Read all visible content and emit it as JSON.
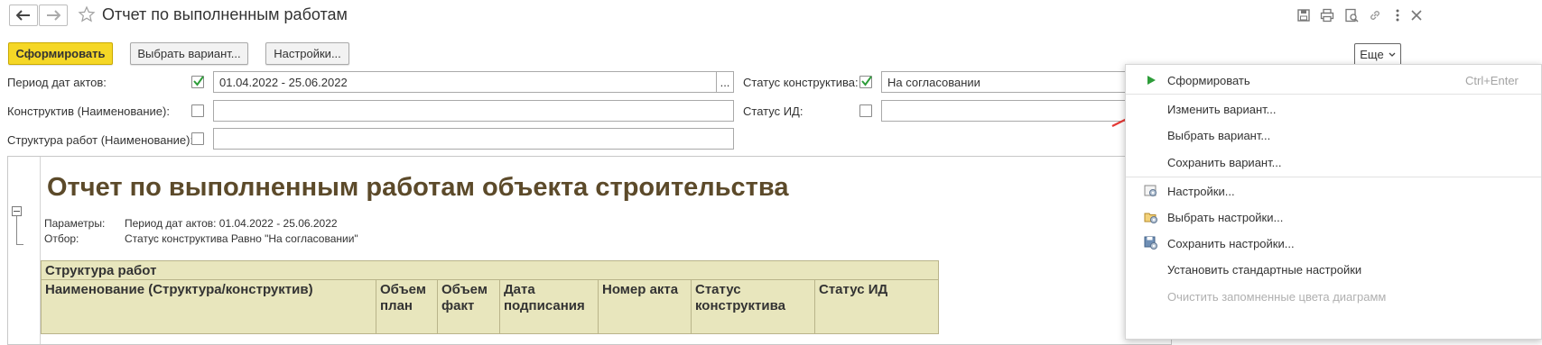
{
  "window": {
    "title": "Отчет по выполненным работам"
  },
  "toolbar": {
    "generate_label": "Сформировать",
    "choose_variant_label": "Выбрать вариант...",
    "settings_label": "Настройки...",
    "more_label": "Еще"
  },
  "filters": {
    "period_label": "Период дат актов:",
    "period_checked": true,
    "period_value": "01.04.2022 - 25.06.2022",
    "period_select_label": "...",
    "construct_label": "Конструктив (Наименование):",
    "construct_checked": false,
    "construct_value": "",
    "structure_label": "Структура работ (Наименование):",
    "structure_checked": false,
    "structure_value": "",
    "construct_status_label": "Статус конструктива:",
    "construct_status_checked": true,
    "construct_status_value": "На согласовании",
    "id_status_label": "Статус ИД:",
    "id_status_checked": false,
    "id_status_value": ""
  },
  "report": {
    "title": "Отчет по выполненным работам объекта строительства",
    "params_label": "Параметры:",
    "params_value": "Период дат актов: 01.04.2022 - 25.06.2022",
    "filter_label": "Отбор:",
    "filter_value": "Статус конструктива Равно \"На согласовании\"",
    "group_header": "Структура работ",
    "columns": [
      "Наименование (Структура/конструктив)",
      "Объем план",
      "Объем факт",
      "Дата подписания",
      "Номер акта",
      "Статус конструктива",
      "Статус ИД"
    ]
  },
  "menu": {
    "items": [
      {
        "label": "Сформировать",
        "shortcut": "Ctrl+Enter",
        "icon": "play-icon",
        "enabled": true
      },
      {
        "label": "Изменить вариант...",
        "icon": "",
        "enabled": true
      },
      {
        "label": "Выбрать вариант...",
        "icon": "",
        "enabled": true
      },
      {
        "label": "Сохранить вариант...",
        "icon": "",
        "enabled": true
      },
      {
        "label": "Настройки...",
        "icon": "settings-gear-icon",
        "enabled": true
      },
      {
        "label": "Выбрать настройки...",
        "icon": "folder-gear-icon",
        "enabled": true
      },
      {
        "label": "Сохранить настройки...",
        "icon": "save-gear-icon",
        "enabled": true
      },
      {
        "label": "Установить стандартные настройки",
        "icon": "",
        "enabled": true
      },
      {
        "label": "Очистить запомненные цвета диаграмм",
        "icon": "",
        "enabled": false
      }
    ]
  },
  "colors": {
    "primary_button": "#f5d726",
    "report_title": "#5c4a2a",
    "table_header_bg": "#e8e6bd",
    "annotation_arrow": "#e53935",
    "check_green": "#2e9d3a"
  }
}
